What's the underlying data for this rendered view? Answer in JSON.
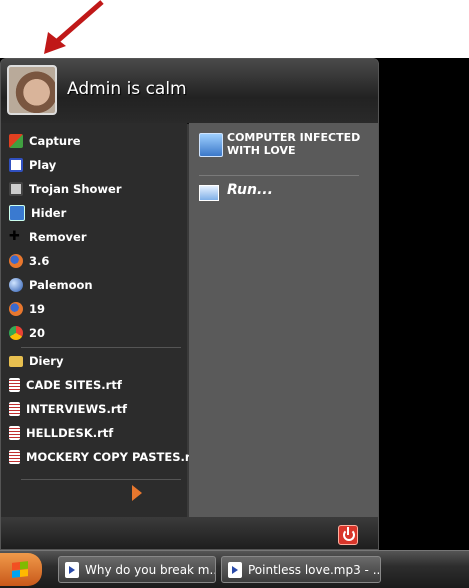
{
  "user": {
    "name": "Admin is calm"
  },
  "programs": [
    {
      "label": "Capture",
      "icon": "capture-icon",
      "color": "#e04020"
    },
    {
      "label": "Play",
      "icon": "play-icon",
      "color": "#3050c0"
    },
    {
      "label": "Trojan Shower",
      "icon": "computer-icon",
      "color": "#8a8a8a"
    },
    {
      "label": "Hider",
      "icon": "hider-icon",
      "color": "#3a7ad0"
    },
    {
      "label": "Remover",
      "icon": "cursor-icon",
      "color": "#111111"
    },
    {
      "label": "3.6",
      "icon": "firefox-icon",
      "color": "#e8772e"
    },
    {
      "label": "Palemoon",
      "icon": "palemoon-icon",
      "color": "#4a8ad8"
    },
    {
      "label": "19",
      "icon": "firefox-icon",
      "color": "#e8772e"
    },
    {
      "label": "20",
      "icon": "chrome-icon",
      "color": "#34a853"
    }
  ],
  "recent": [
    {
      "label": "Diery",
      "icon": "folder-icon",
      "color": "#e8c050"
    },
    {
      "label": "CADE SITES.rtf",
      "icon": "document-icon",
      "color": "#ffffff"
    },
    {
      "label": "INTERVIEWS.rtf",
      "icon": "document-icon",
      "color": "#ffffff"
    },
    {
      "label": "HELLDESK.rtf",
      "icon": "document-icon",
      "color": "#ffffff"
    },
    {
      "label": "MOCKERY COPY PASTES.rtf",
      "icon": "document-icon",
      "color": "#ffffff"
    }
  ],
  "places": {
    "computer_line1": "COMPUTER INFECTED",
    "computer_line2": "WITH LOVE",
    "run": "Run..."
  },
  "taskbar": {
    "tasks": [
      {
        "label": "Why do you break m..."
      },
      {
        "label": "Pointless love.mp3 - ..."
      }
    ]
  }
}
